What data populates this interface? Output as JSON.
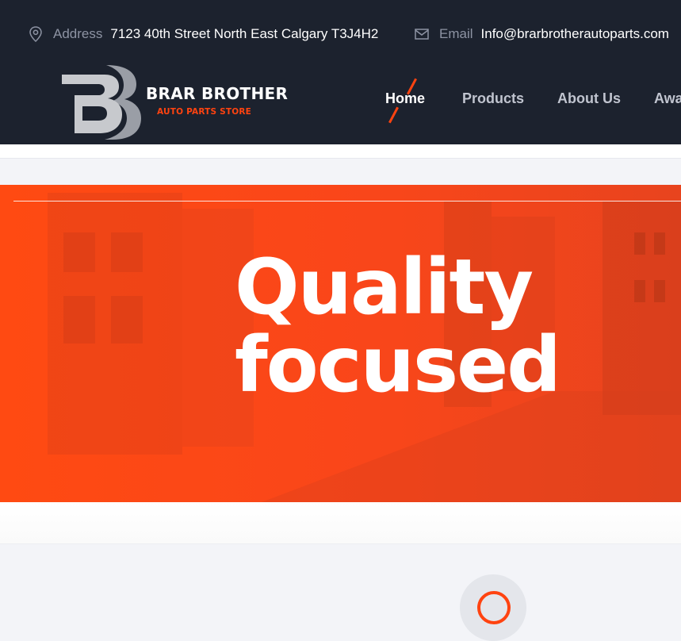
{
  "topbar": {
    "address_label": "Address",
    "address_value": "7123 40th Street North East Calgary T3J4H2",
    "email_label": "Email",
    "email_value": "Info@brarbrotherautoparts.com"
  },
  "brand": {
    "name": "BRAR BROTHER",
    "tagline": "AUTO PARTS STORE"
  },
  "nav": {
    "items": [
      "Home",
      "Products",
      "About Us",
      "Awa"
    ],
    "active": "Home"
  },
  "hero": {
    "line1": "Quality",
    "line2": "focused"
  },
  "colors": {
    "accent": "#ff4310",
    "header_bg": "#1c222e",
    "page_bg": "#f3f4f8"
  },
  "icons": [
    "location-pin-icon",
    "envelope-icon",
    "brand-logo-icon",
    "feature-icon"
  ]
}
